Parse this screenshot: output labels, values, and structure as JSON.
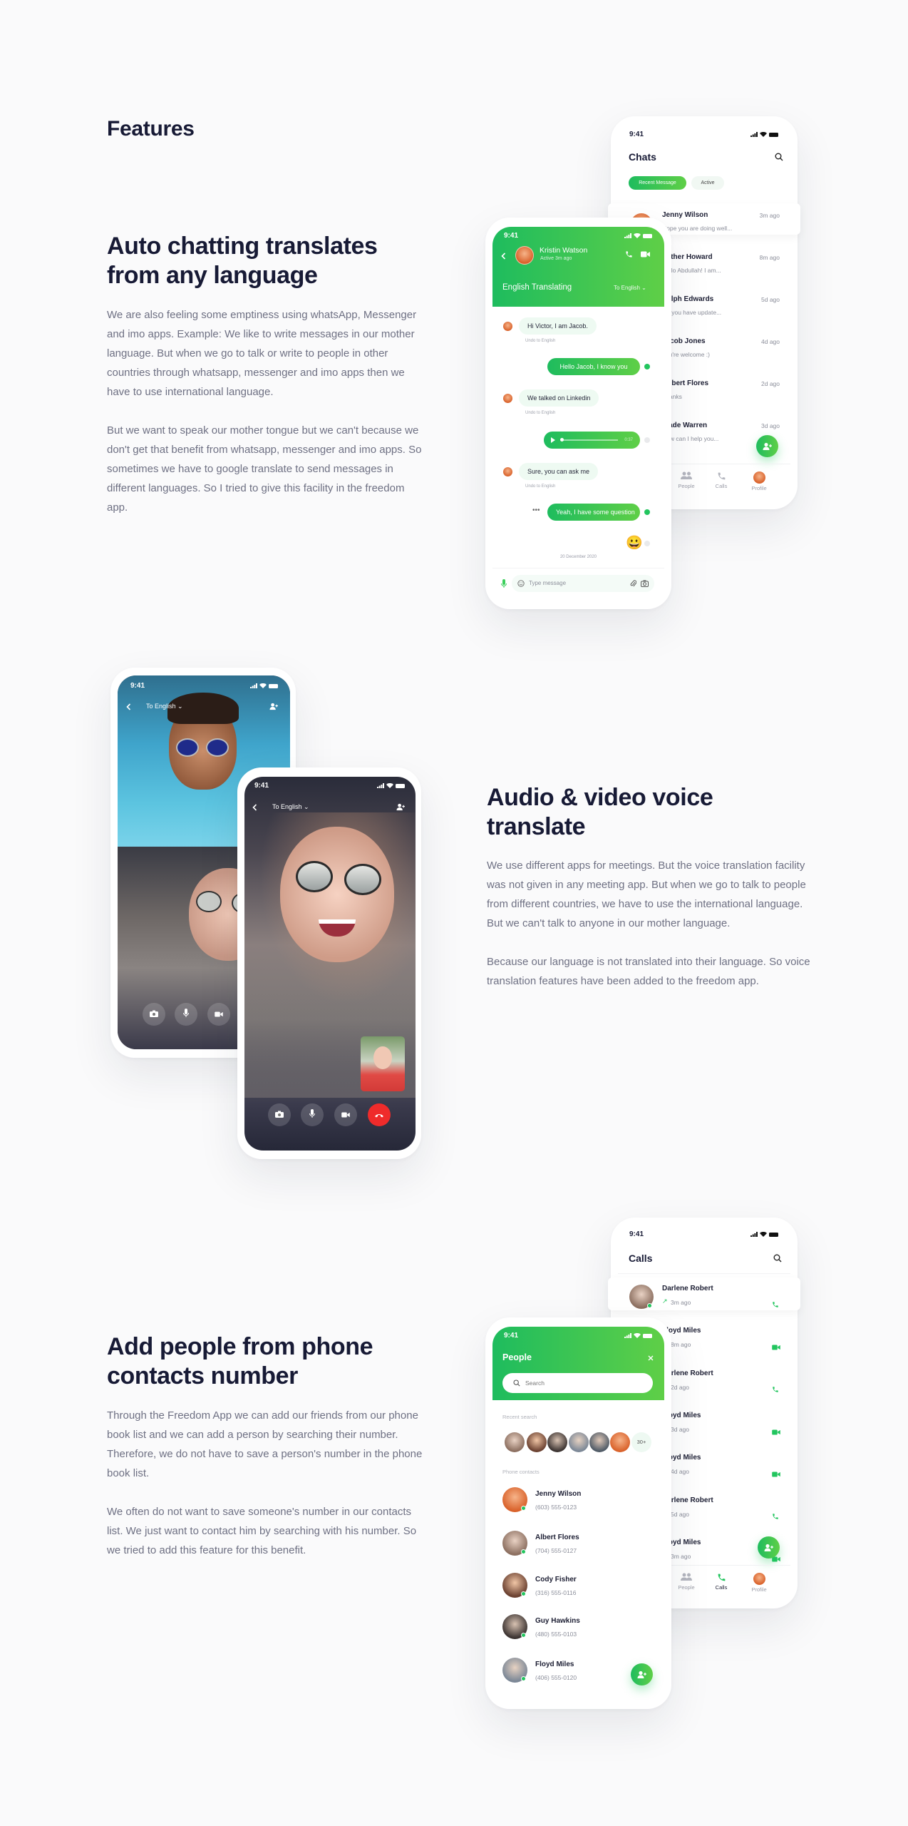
{
  "page": {
    "title": "Features"
  },
  "colors": {
    "accent": "#22c55e",
    "accent_end": "#5fcf47",
    "heading": "#171a35",
    "body_text": "#6e7083",
    "end_call": "#ef2b2b"
  },
  "features": [
    {
      "heading_lines": [
        "Auto chatting translates",
        "from any language"
      ],
      "paragraphs": [
        "We are also feeling some emptiness using whatsApp, Messenger and imo apps. Example: We like to write messages in our mother language. But when we go to talk or write to people in other countries through whatsapp, messenger and imo apps then we have to use international language.",
        "But we want to speak our mother tongue but we can't because we don't get that benefit from whatsapp, messenger and imo apps. So sometimes we have to google translate to send messages in different languages. So I tried to give this facility in the freedom app."
      ]
    },
    {
      "heading_lines": [
        "Audio & video voice",
        "translate"
      ],
      "paragraphs": [
        "We use different apps for meetings. But the voice translation facility was not given in any meeting app. But when we go to talk to people from different countries, we have to use the international language. But we can't talk to anyone in our mother language.",
        "Because our language is not translated into their language. So voice translation features have been added to the freedom app."
      ]
    },
    {
      "heading_lines": [
        "Add people from phone",
        "contacts number"
      ],
      "paragraphs": [
        "Through the Freedom App we can add our friends from our phone book list and we can add a person by searching their number. Therefore, we do not have to save a person's number in the phone book list.",
        "We often do not want to save someone's number in our contacts list. We just want to contact him by searching with his number. So we tried to add this feature for this benefit."
      ]
    }
  ],
  "status_time": "9:41",
  "chats_screen": {
    "title": "Chats",
    "tabs": [
      {
        "label": "Recent Message",
        "active": true
      },
      {
        "label": "Active",
        "active": false
      }
    ],
    "items": [
      {
        "name": "Jenny Wilson",
        "preview": "Hope you are doing well...",
        "time": "3m ago"
      },
      {
        "name": "Esther Howard",
        "preview": "Hello Abdullah! I am...",
        "time": "8m ago"
      },
      {
        "name": "Ralph Edwards",
        "preview": "Do you have update...",
        "time": "5d ago"
      },
      {
        "name": "Jacob Jones",
        "preview": "You're welcome :)",
        "time": "4d ago"
      },
      {
        "name": "Robert Flores",
        "preview": "Thanks",
        "time": "2d ago"
      },
      {
        "name": "Wade Warren",
        "preview": "How can I help you...",
        "time": "3d ago"
      }
    ],
    "nav": [
      {
        "label": "People",
        "icon": "people-icon"
      },
      {
        "label": "Calls",
        "icon": "phone-icon"
      },
      {
        "label": "Profile",
        "icon": "avatar"
      }
    ]
  },
  "conversation": {
    "contact_name": "Kristin Watson",
    "contact_status": "Active 3m ago",
    "translating_label": "English Translating",
    "language": "To English",
    "messages": [
      {
        "dir": "in",
        "text": "Hi Victor, I am Jacob.",
        "sub": "Undo to English"
      },
      {
        "dir": "out",
        "text": "Hello Jacob, I know you"
      },
      {
        "dir": "in",
        "text": "We talked on Linkedin",
        "sub": "Undo to English"
      },
      {
        "dir": "out-audio",
        "duration": "0:37"
      },
      {
        "dir": "in",
        "text": "Sure, you can ask me",
        "sub": "Undo to English"
      },
      {
        "dir": "out",
        "text": "Yeah, I have some question"
      },
      {
        "dir": "out-emoji",
        "text": "😀"
      }
    ],
    "date": "20 December 2020",
    "input_placeholder": "Type message"
  },
  "video_calls": {
    "language": "To English"
  },
  "calls_screen": {
    "title": "Calls",
    "items": [
      {
        "name": "Darlene Robert",
        "time": "3m ago",
        "type": "voice",
        "outgoing": true
      },
      {
        "name": "Floyd Miles",
        "time": "8m ago",
        "type": "video"
      },
      {
        "name": "Darlene Robert",
        "time": "2d ago",
        "type": "voice"
      },
      {
        "name": "Floyd Miles",
        "time": "3d ago",
        "type": "video"
      },
      {
        "name": "Floyd Miles",
        "time": "4d ago",
        "type": "video"
      },
      {
        "name": "Darlene Robert",
        "time": "5d ago",
        "type": "voice"
      },
      {
        "name": "Floyd Miles",
        "time": "3m ago",
        "type": "video"
      }
    ],
    "nav": [
      {
        "label": "People",
        "icon": "people-icon"
      },
      {
        "label": "Calls",
        "icon": "phone-icon",
        "active": true
      },
      {
        "label": "Profile",
        "icon": "avatar"
      }
    ]
  },
  "people_screen": {
    "title": "People",
    "search_placeholder": "Search",
    "recent_label": "Recent search",
    "recent_more": "30+",
    "contacts_label": "Phone contacts",
    "contacts": [
      {
        "name": "Jenny Wilson",
        "phone": "(603) 555-0123"
      },
      {
        "name": "Albert Flores",
        "phone": "(704) 555-0127"
      },
      {
        "name": "Cody Fisher",
        "phone": "(316) 555-0116"
      },
      {
        "name": "Guy Hawkins",
        "phone": "(480) 555-0103"
      },
      {
        "name": "Floyd Miles",
        "phone": "(406) 555-0120"
      }
    ]
  }
}
